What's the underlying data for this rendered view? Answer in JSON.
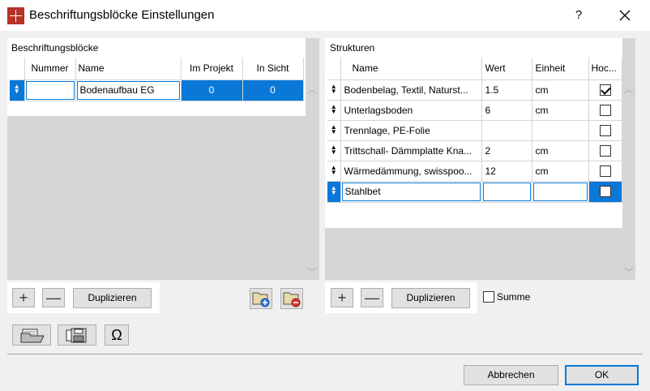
{
  "window": {
    "title": "Beschriftungsblöcke Einstellungen",
    "help": "?",
    "close": "✕"
  },
  "left": {
    "title": "Beschriftungsblöcke",
    "columns": [
      "Nummer",
      "Name",
      "Im Projekt",
      "In Sicht"
    ],
    "rows": [
      {
        "nummer": "",
        "name": "Bodenaufbau EG",
        "im_projekt": "0",
        "in_sicht": "0"
      }
    ],
    "add": "+",
    "remove": "—",
    "duplicate": "Duplizieren"
  },
  "right": {
    "title": "Strukturen",
    "columns": [
      "Name",
      "Wert",
      "Einheit",
      "Hoc..."
    ],
    "rows": [
      {
        "name": "Bodenbelag, Textil, Naturst...",
        "wert": "1.5",
        "einheit": "cm",
        "hoc": true
      },
      {
        "name": "Unterlagsboden",
        "wert": "6",
        "einheit": "cm",
        "hoc": false
      },
      {
        "name": "Trennlage, PE-Folie",
        "wert": "",
        "einheit": "",
        "hoc": false
      },
      {
        "name": "Trittschall- Dämmplatte Kna...",
        "wert": "2",
        "einheit": "cm",
        "hoc": false
      },
      {
        "name": "Wärmedämmung, swisspoo...",
        "wert": "12",
        "einheit": "cm",
        "hoc": false
      },
      {
        "name": "Stahlbet",
        "wert": "",
        "einheit": "",
        "hoc": false
      }
    ],
    "add": "+",
    "remove": "—",
    "duplicate": "Duplizieren",
    "summe": "Summe"
  },
  "footer": {
    "cancel": "Abbrechen",
    "ok": "OK",
    "omega": "Ω"
  },
  "colors": {
    "accent": "#0a78d7",
    "brand": "#b83228"
  }
}
